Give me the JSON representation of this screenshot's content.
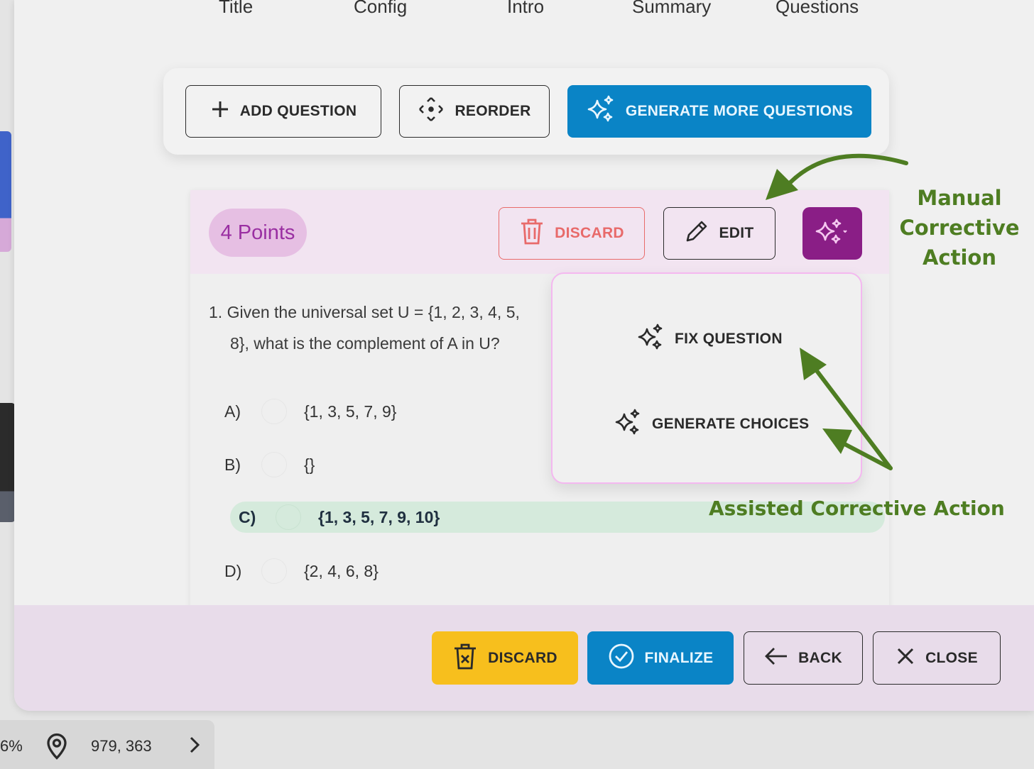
{
  "steps": [
    "Title",
    "Config",
    "Intro",
    "Summary",
    "Questions"
  ],
  "toolbar": {
    "add_question": "ADD QUESTION",
    "reorder": "REORDER",
    "generate_more": "GENERATE MORE QUESTIONS"
  },
  "question": {
    "points": "4 Points",
    "discard": "DISCARD",
    "edit": "EDIT",
    "line1": "1.  Given the universal set U = {1, 2, 3, 4, 5,",
    "line2": "8}, what is the complement of A in U?",
    "options": [
      {
        "label": "A)",
        "value": "{1, 3, 5, 7, 9}"
      },
      {
        "label": "B)",
        "value": "{}"
      },
      {
        "label": "C)",
        "value": "{1, 3, 5, 7, 9, 10}"
      },
      {
        "label": "D)",
        "value": "{2, 4, 6, 8}"
      }
    ],
    "correct_option": "C)"
  },
  "assist_menu": {
    "fix_question": "FIX QUESTION",
    "generate_choices": "GENERATE CHOICES"
  },
  "footer": {
    "discard": "DISCARD",
    "finalize": "FINALIZE",
    "back": "BACK",
    "close": "CLOSE"
  },
  "status_bar": {
    "zoom": "6%",
    "coords": "979, 363"
  },
  "annotations": {
    "manual_line1": "Manual",
    "manual_line2": "Corrective",
    "manual_line3": "Action",
    "assisted": "Assisted Corrective Action"
  },
  "colors": {
    "primary_blue": "#0a84c6",
    "magic_purple": "#8a1e86",
    "discard_red": "#e86a6a",
    "warning_yellow": "#f7bf1d",
    "annotation_green": "#4e7d22",
    "correct_bg": "#d5eadc"
  },
  "icons": [
    "plus-icon",
    "move-icon",
    "sparkles-icon",
    "trash-icon",
    "pencil-icon",
    "check-circle-icon",
    "arrow-left-icon",
    "close-icon",
    "location-pin-icon",
    "chevron-right-icon"
  ]
}
